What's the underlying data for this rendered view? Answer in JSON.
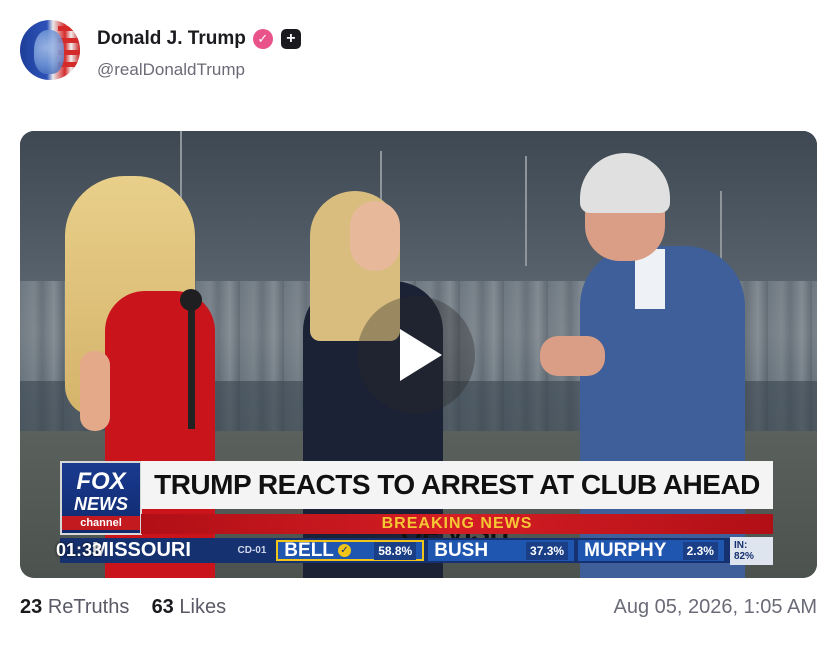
{
  "author": {
    "display_name": "Donald J. Trump",
    "handle": "@realDonaldTrump",
    "verified_icon": "verified-check-icon",
    "plus_icon": "plus-badge-icon"
  },
  "video": {
    "timestamp": "01:33",
    "play_icon": "play-icon",
    "lower_third": {
      "network_line1": "FOX",
      "network_line2": "NEWS",
      "network_line3": "channel",
      "headline": "TRUMP REACTS TO ARREST AT CLUB AHEAD OF VISIT",
      "banner": "BREAKING NEWS",
      "state": "MISSOURI",
      "district": "CD-01",
      "candidates": [
        {
          "name": "BELL",
          "pct": "58.8%",
          "winner": true
        },
        {
          "name": "BUSH",
          "pct": "37.3%"
        },
        {
          "name": "MURPHY",
          "pct": "2.3%"
        }
      ],
      "reporting": "IN: 82%"
    }
  },
  "stats": {
    "retruths_count": "23",
    "retruths_label": "ReTruths",
    "likes_count": "63",
    "likes_label": "Likes"
  },
  "posted_at": "Aug 05, 2026, 1:05 AM"
}
